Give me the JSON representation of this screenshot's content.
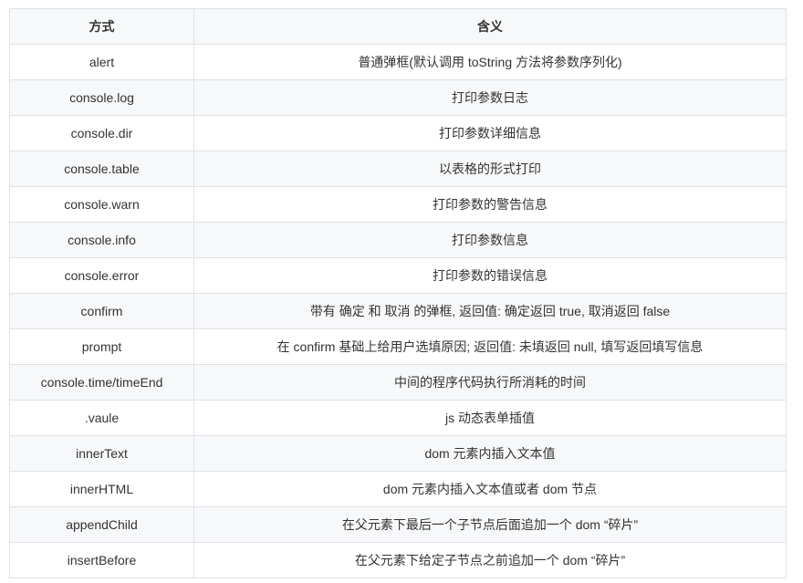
{
  "table": {
    "headers": [
      "方式",
      "含义"
    ],
    "rows": [
      [
        "alert",
        "普通弹框(默认调用 toString 方法将参数序列化)"
      ],
      [
        "console.log",
        "打印参数日志"
      ],
      [
        "console.dir",
        "打印参数详细信息"
      ],
      [
        "console.table",
        "以表格的形式打印"
      ],
      [
        "console.warn",
        "打印参数的警告信息"
      ],
      [
        "console.info",
        "打印参数信息"
      ],
      [
        "console.error",
        "打印参数的错误信息"
      ],
      [
        "confirm",
        "带有 确定 和 取消 的弹框, 返回值: 确定返回 true, 取消返回 false"
      ],
      [
        "prompt",
        "在 confirm 基础上给用户选填原因; 返回值: 未填返回 null, 填写返回填写信息"
      ],
      [
        "console.time/timeEnd",
        "中间的程序代码执行所消耗的时间"
      ],
      [
        ".vaule",
        "js 动态表单插值"
      ],
      [
        "innerText",
        "dom 元素内插入文本值"
      ],
      [
        "innerHTML",
        "dom 元素内插入文本值或者 dom 节点"
      ],
      [
        "appendChild",
        "在父元素下最后一个子节点后面追加一个 dom “碎片”"
      ],
      [
        "insertBefore",
        "在父元素下给定子节点之前追加一个 dom “碎片”"
      ]
    ]
  }
}
